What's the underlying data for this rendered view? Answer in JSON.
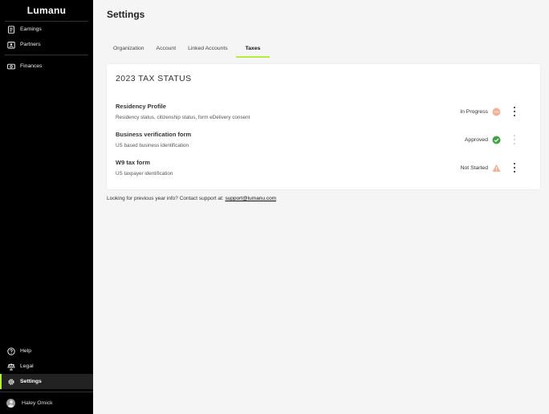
{
  "app": {
    "logo": "Lumanu"
  },
  "sidebar": {
    "top_items": [
      {
        "label": "Earnings",
        "icon": "receipt-icon"
      },
      {
        "label": "Partners",
        "icon": "id-card-icon"
      }
    ],
    "mid_items": [
      {
        "label": "Finances",
        "icon": "cash-icon"
      }
    ],
    "bottom_items": [
      {
        "label": "Help",
        "icon": "help-circle-icon"
      },
      {
        "label": "Legal",
        "icon": "scale-icon"
      },
      {
        "label": "Settings",
        "icon": "gear-icon",
        "active": true
      }
    ],
    "user": {
      "name": "Haley Omick"
    }
  },
  "page": {
    "title": "Settings"
  },
  "tabs": [
    {
      "label": "Organization"
    },
    {
      "label": "Account"
    },
    {
      "label": "Linked Accounts"
    },
    {
      "label": "Taxes",
      "active": true
    }
  ],
  "tax_card": {
    "title": "2023 TAX STATUS",
    "rows": [
      {
        "title": "Residency Profile",
        "subtitle": "Residency status, citizenship status, form eDelivery consent",
        "status": "In Progress",
        "status_icon": "in-progress-icon",
        "status_color": "#f2b199"
      },
      {
        "title": "Business verification form",
        "subtitle": "US based business identification",
        "status": "Approved",
        "status_icon": "check-circle-icon",
        "status_color": "#43a047"
      },
      {
        "title": "W9 tax form",
        "subtitle": "US taxpayer identification",
        "status": "Not Started",
        "status_icon": "warning-icon",
        "status_color": "#f2b199"
      }
    ]
  },
  "footer": {
    "text": "Looking for previous year info? Contact support at:",
    "link": "support@lumanu.com"
  },
  "colors": {
    "accent": "#b3ef3a",
    "sidebar_bg": "#000000",
    "page_bg": "#f5f5f5"
  }
}
